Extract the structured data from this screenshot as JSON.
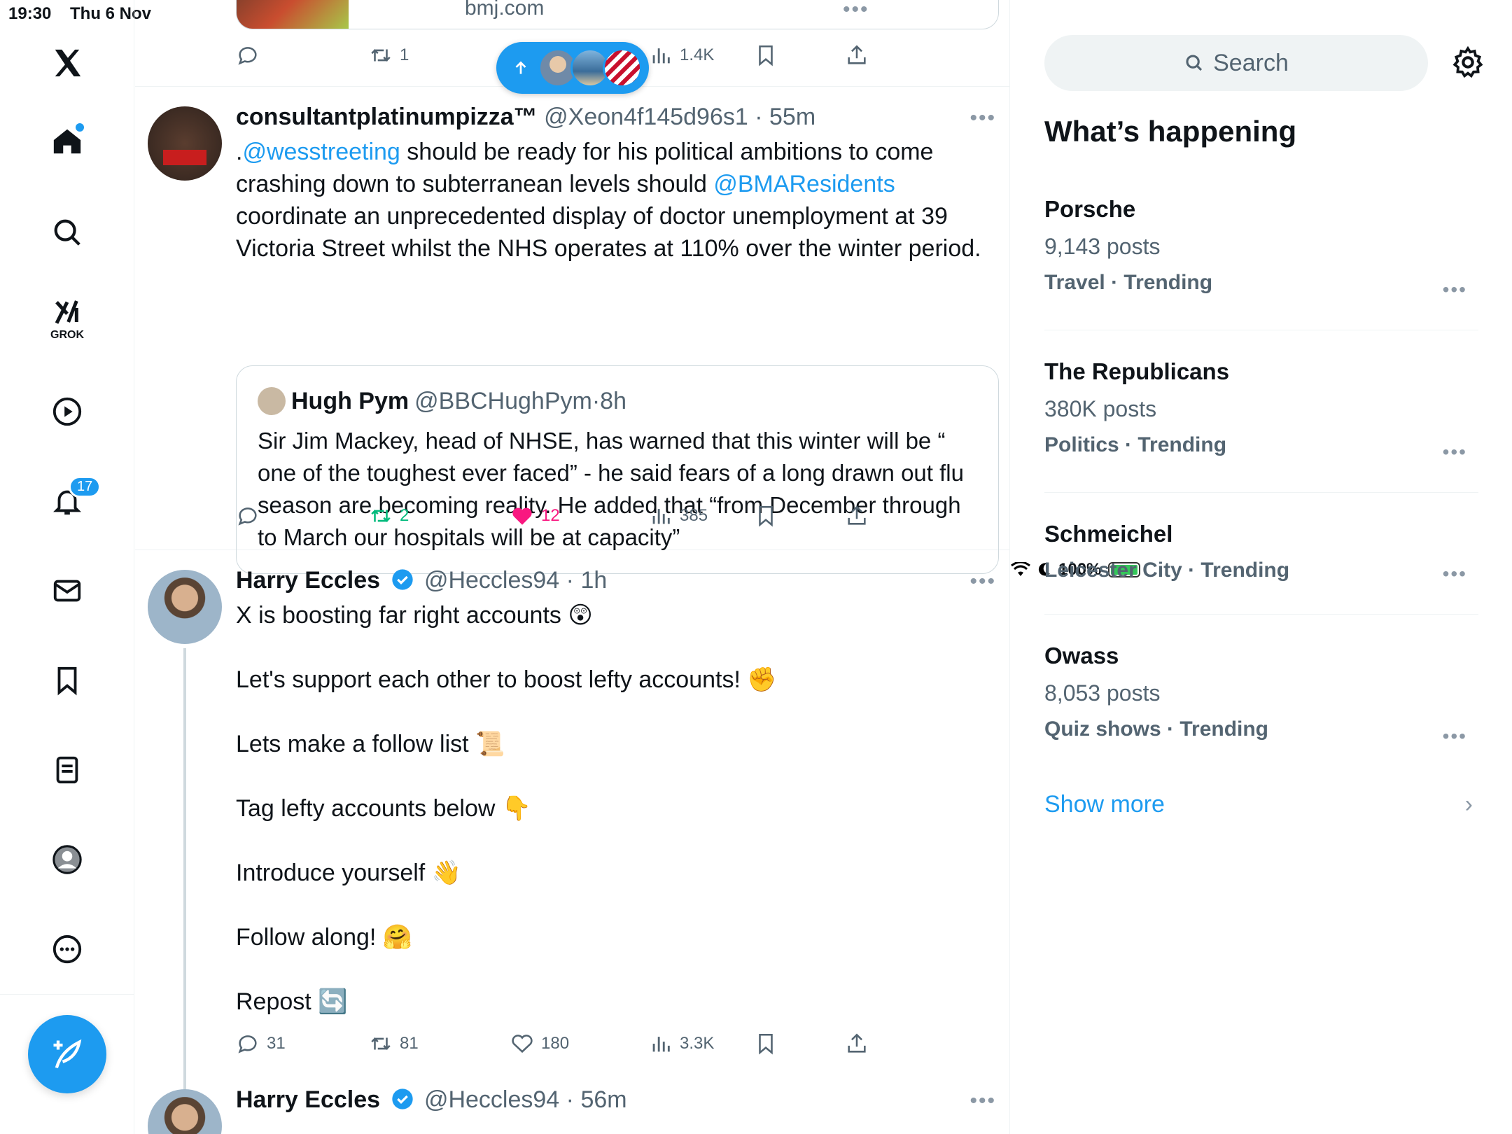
{
  "status_bar": {
    "time": "19:30",
    "date": "Thu 6 Nov",
    "battery": "100%"
  },
  "nav": {
    "grok_label": "GROK",
    "notifications_badge": "17"
  },
  "top_tweet_fragment": {
    "link_domain": "bmj.com",
    "retweets": "1",
    "views": "1.4K"
  },
  "tweet1": {
    "name": "consultantplatinumpizza™",
    "handle": "@Xeon4f145d96s1",
    "time": "55m",
    "text_pre": ".",
    "mention1": "@wesstreeting",
    "text_mid": " should be ready for his political ambitions to come crashing down to subterranean levels should ",
    "mention2": "@BMAResidents",
    "text_post": " coordinate an unprecedented display of doctor unemployment at 39 Victoria Street whilst the NHS operates at 110% over the winter period.",
    "quote": {
      "name": "Hugh Pym",
      "handle": "@BBCHughPym",
      "time": "8h",
      "text": "Sir Jim Mackey, head of NHSE, has warned that this winter will be “ one of the toughest ever faced” - he said fears of a long drawn out flu season are becoming reality. He added that “from December through to March our hospitals will be at capacity”"
    },
    "retweets": "2",
    "likes": "12",
    "views": "385"
  },
  "tweet2": {
    "name": "Harry Eccles",
    "handle": "@Heccles94",
    "time": "1h",
    "lines": [
      "X is boosting far right accounts 😲",
      "Let's support each other to boost lefty accounts! ✊",
      "Lets make a follow list 📜",
      "Tag lefty accounts below 👇",
      "Introduce yourself 👋",
      "Follow along! 🤗",
      "Repost 🔄"
    ],
    "replies": "31",
    "retweets": "81",
    "likes": "180",
    "views": "3.3K"
  },
  "tweet3": {
    "name": "Harry Eccles",
    "handle": "@Heccles94",
    "time": "56m"
  },
  "search": {
    "placeholder": "Search"
  },
  "whats_happening": {
    "title": "What’s happening",
    "trends": [
      {
        "name": "Porsche",
        "count": "9,143 posts",
        "category": "Travel · Trending"
      },
      {
        "name": "The Republicans",
        "count": "380K posts",
        "category": "Politics · Trending"
      },
      {
        "name": "Schmeichel",
        "count": "",
        "category": "Leicester City · Trending"
      },
      {
        "name": "Owass",
        "count": "8,053 posts",
        "category": "Quiz shows · Trending"
      }
    ],
    "show_more": "Show more"
  },
  "colors": {
    "accent": "#1d9bf0",
    "like": "#f91880",
    "retweet_active": "#00ba7c",
    "muted": "#536471"
  }
}
